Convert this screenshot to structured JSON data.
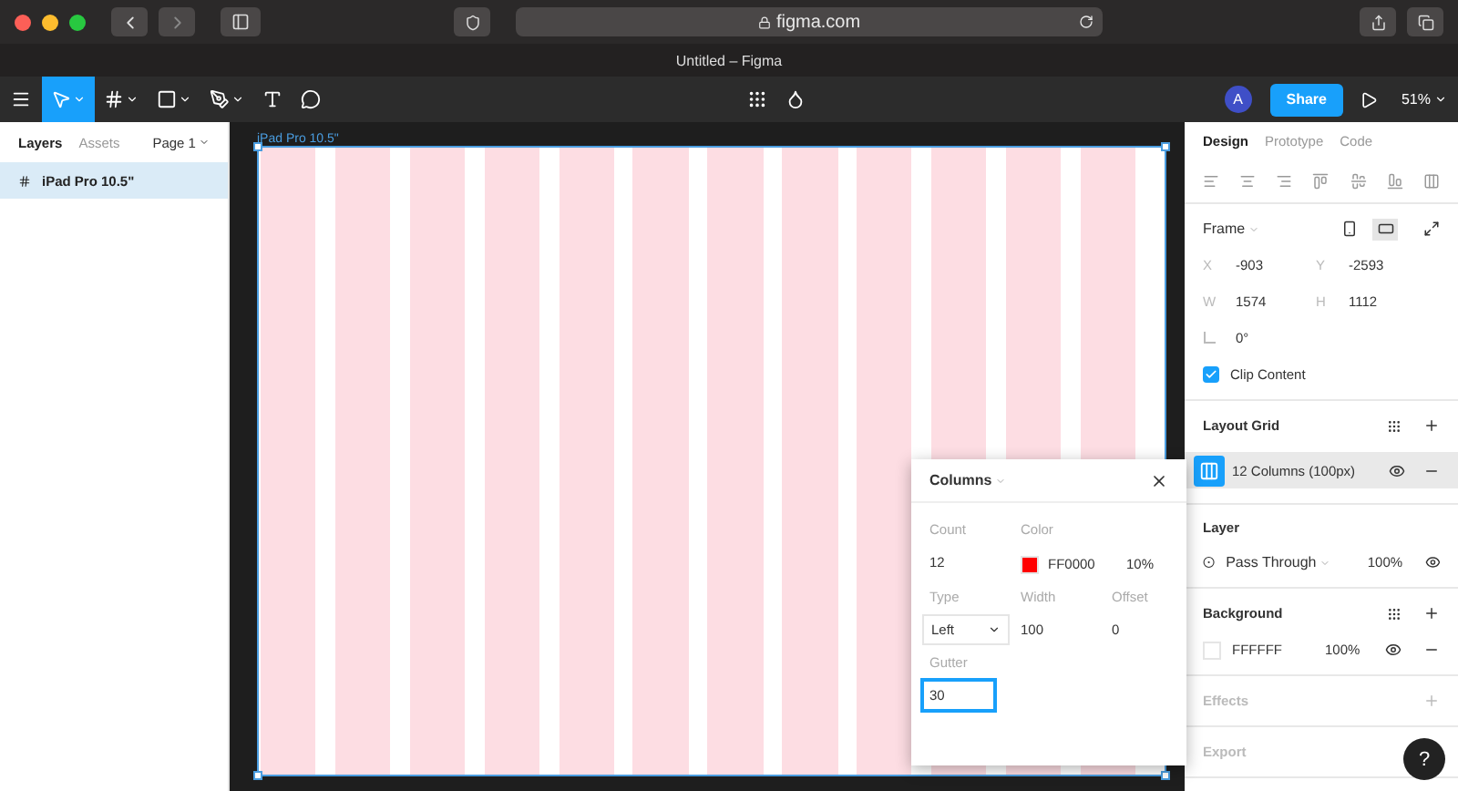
{
  "browser": {
    "url": "figma.com"
  },
  "window": {
    "title": "Untitled – Figma"
  },
  "toolbar": {
    "tools": [
      {
        "kind": "move",
        "selected": true
      },
      {
        "kind": "frame",
        "selected": false
      },
      {
        "kind": "shape",
        "selected": false
      },
      {
        "kind": "pen",
        "selected": false
      },
      {
        "kind": "text",
        "selected": false
      },
      {
        "kind": "comment",
        "selected": false
      }
    ],
    "avatar": "A",
    "share": "Share",
    "zoom": "51%"
  },
  "left_panel": {
    "tabs": [
      {
        "label": "Layers",
        "selected": true
      },
      {
        "label": "Assets",
        "selected": false
      }
    ],
    "page": "Page 1",
    "layers": [
      {
        "name": "iPad Pro 10.5\"",
        "selected": true
      }
    ]
  },
  "canvas": {
    "frame_label": "iPad Pro 10.5\""
  },
  "grid_popup": {
    "title": "Columns",
    "fields": [
      {
        "label": "Count",
        "value": "12",
        "kind": "text"
      },
      {
        "label": "Color",
        "value": "FF0000",
        "extra": "10%",
        "kind": "color"
      },
      {
        "label": "Type",
        "value": "Left",
        "kind": "select"
      },
      {
        "label": "Width",
        "value": "100",
        "kind": "text"
      },
      {
        "label": "Offset",
        "value": "0",
        "kind": "text"
      },
      {
        "label": "Gutter",
        "value": "30",
        "kind": "input"
      }
    ]
  },
  "right_panel": {
    "tabs": [
      {
        "label": "Design",
        "selected": true
      },
      {
        "label": "Prototype",
        "selected": false
      },
      {
        "label": "Code",
        "selected": false
      }
    ],
    "frame": {
      "title": "Frame",
      "orientation_landscape": true,
      "fields": [
        {
          "label": "X",
          "value": "-903"
        },
        {
          "label": "Y",
          "value": "-2593"
        },
        {
          "label": "W",
          "value": "1574"
        },
        {
          "label": "H",
          "value": "1112"
        }
      ],
      "rotation": "0°",
      "clip_content": {
        "label": "Clip Content",
        "checked": true
      }
    },
    "layout_grid": {
      "title": "Layout Grid",
      "grids": [
        {
          "label": "12 Columns (100px)",
          "selected": true
        }
      ]
    },
    "layer": {
      "title": "Layer",
      "blend": "Pass Through",
      "opacity": "100%"
    },
    "background": {
      "title": "Background",
      "color": "FFFFFF",
      "opacity": "100%"
    },
    "effects": {
      "title": "Effects"
    },
    "export": {
      "title": "Export"
    }
  },
  "help": "?"
}
